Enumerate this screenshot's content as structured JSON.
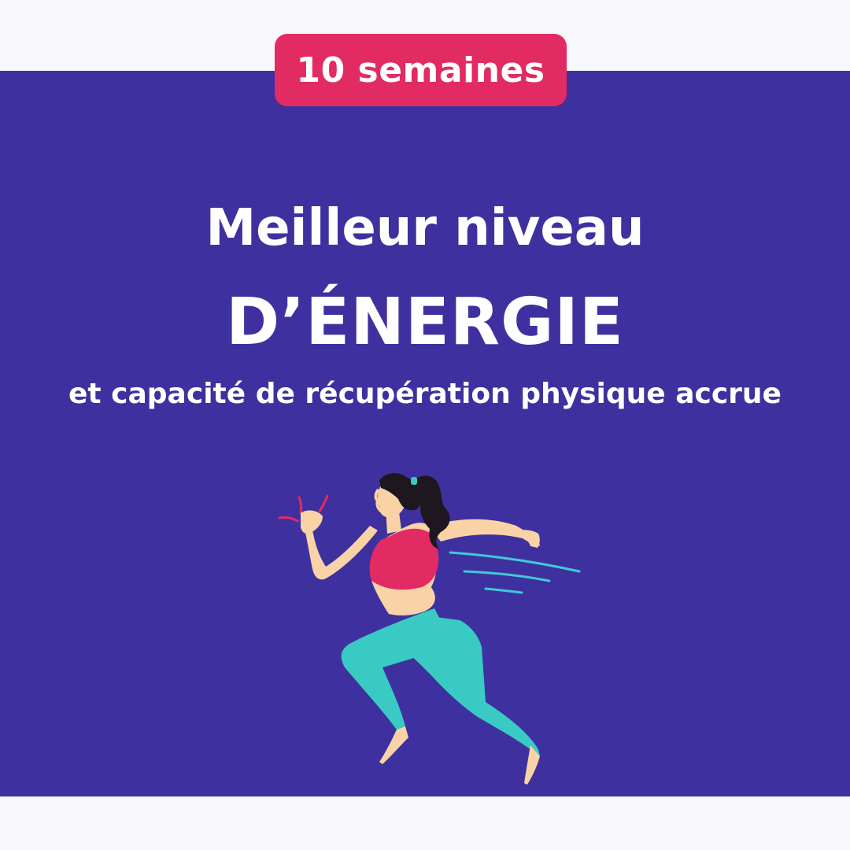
{
  "badge": {
    "label": "10 semaines"
  },
  "headline": {
    "line1": "Meilleur niveau",
    "line2": "D’ÉNERGIE",
    "line3": "et capacité de récupération physique accrue"
  },
  "illustration": {
    "name": "running-woman-illustration"
  },
  "colors": {
    "background": "#F7F7FC",
    "panel": "#3E319F",
    "badge": "#E22A63",
    "text": "#FFFFFF",
    "skin": "#F9D3A6",
    "hair": "#1F1720",
    "top": "#E22A63",
    "leggings": "#39CBC3",
    "speed_lines": "#41C8D7",
    "motion_marks": "#E22A63"
  }
}
